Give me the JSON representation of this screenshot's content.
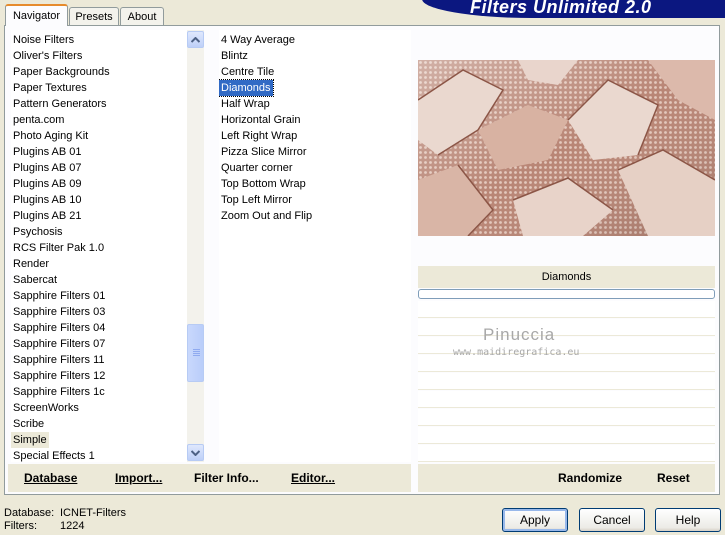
{
  "banner": {
    "title": "Filters Unlimited 2.0"
  },
  "tabs": [
    {
      "label": "Navigator",
      "active": true
    },
    {
      "label": "Presets",
      "active": false
    },
    {
      "label": "About",
      "active": false
    }
  ],
  "categories": {
    "items": [
      "Noise Filters",
      "Oliver's Filters",
      "Paper Backgrounds",
      "Paper Textures",
      "Pattern Generators",
      "penta.com",
      "Photo Aging Kit",
      "Plugins AB 01",
      "Plugins AB 07",
      "Plugins AB 09",
      "Plugins AB 10",
      "Plugins AB 21",
      "Psychosis",
      "RCS Filter Pak 1.0",
      "Render",
      "Sabercat",
      "Sapphire Filters 01",
      "Sapphire Filters 03",
      "Sapphire Filters 04",
      "Sapphire Filters 07",
      "Sapphire Filters 11",
      "Sapphire Filters 12",
      "Sapphire Filters 1c",
      "ScreenWorks",
      "Scribe",
      "Simple",
      "Special Effects 1"
    ],
    "selected": "Simple"
  },
  "filters": {
    "items": [
      "4 Way Average",
      "Blintz",
      "Centre Tile",
      "Diamonds",
      "Half Wrap",
      "Horizontal Grain",
      "Left Right Wrap",
      "Pizza Slice Mirror",
      "Quarter corner",
      "Top Bottom Wrap",
      "Top Left Mirror",
      "Zoom Out and Flip"
    ],
    "selected": "Diamonds"
  },
  "left_buttons": {
    "database": "Database",
    "import": "Import...",
    "filter_info": "Filter Info...",
    "editor": "Editor..."
  },
  "preview": {
    "filter_name": "Diamonds",
    "progress": 0
  },
  "right_buttons": {
    "randomize": "Randomize",
    "reset": "Reset"
  },
  "watermark": {
    "name": "Pinuccia",
    "site": "www.maidiregrafica.eu"
  },
  "footer": {
    "database_label": "Database:",
    "database_value": "ICNET-Filters",
    "filters_label": "Filters:",
    "filters_value": "1224",
    "apply": "Apply",
    "cancel": "Cancel",
    "help": "Help"
  },
  "colors": {
    "accent": "#316ac5",
    "banner": "#0b1780",
    "window": "#ece9d8"
  },
  "icons": {
    "scroll_up": "chevron-up-icon",
    "scroll_down": "chevron-down-icon"
  }
}
